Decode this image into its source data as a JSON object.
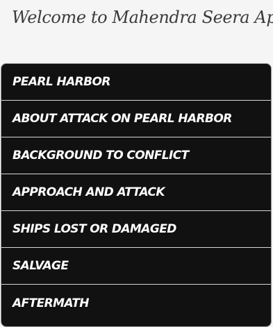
{
  "header": {
    "welcome_text": "Welcome to Mahendra Seera Apps!"
  },
  "menu": {
    "items": [
      {
        "label": "PEARL HARBOR"
      },
      {
        "label": "ABOUT ATTACK ON PEARL HARBOR"
      },
      {
        "label": "BACKGROUND TO CONFLICT"
      },
      {
        "label": "APPROACH AND ATTACK"
      },
      {
        "label": "SHIPS LOST OR DAMAGED"
      },
      {
        "label": "SALVAGE"
      },
      {
        "label": "AFTERMATH"
      }
    ]
  },
  "colors": {
    "page_background": "#f5f5f5",
    "menu_background": "#111111",
    "menu_text": "#ffffff",
    "header_text": "#3b3b3b"
  }
}
